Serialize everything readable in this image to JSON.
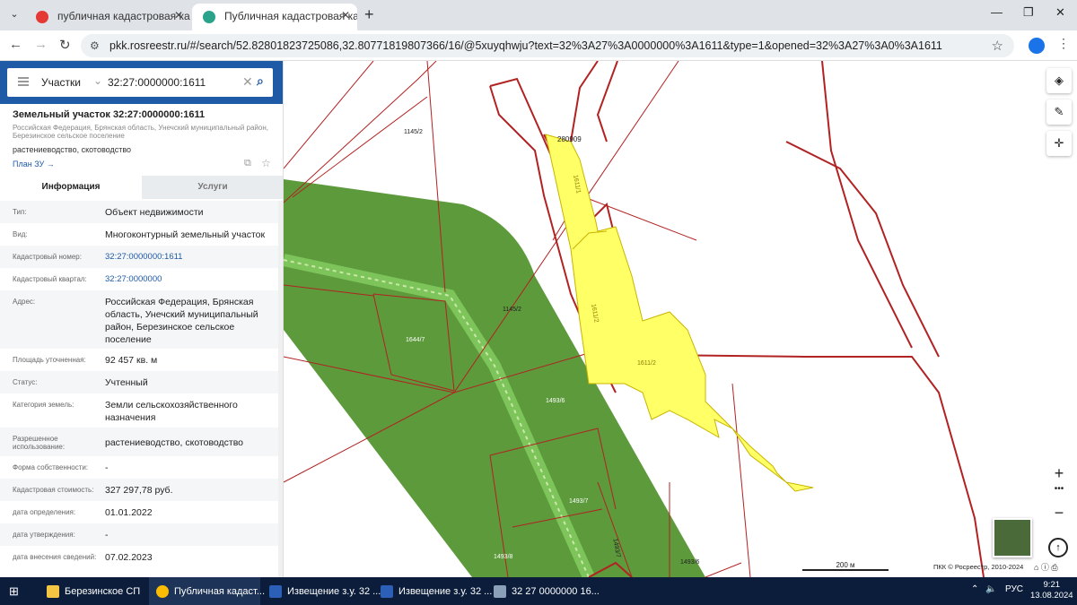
{
  "browser": {
    "tabs": [
      {
        "title": "публичная кадастровая карта",
        "active": false
      },
      {
        "title": "Публичная кадастровая карта",
        "active": true
      }
    ],
    "new_tab": "+",
    "url": "pkk.rosreestr.ru/#/search/52.82801823725086,32.80771819807366/16/@5xuyqhwju?text=32%3A27%3A0000000%3A1611&type=1&opened=32%3A27%3A0%3A1611"
  },
  "search": {
    "type": "Участки",
    "value": "32:27:0000000:1611"
  },
  "object": {
    "title": "Земельный участок 32:27:0000000:1611",
    "address_short": "Российская Федерация, Брянская область, Унечский муниципальный район, Березинское сельское поселение",
    "use": "растениеводство, скотоводство",
    "plan_link": "План ЗУ →"
  },
  "info_tabs": {
    "info": "Информация",
    "services": "Услуги"
  },
  "fields": [
    {
      "k": "Тип:",
      "v": "Объект недвижимости"
    },
    {
      "k": "Вид:",
      "v": "Многоконтурный земельный участок"
    },
    {
      "k": "Кадастровый номер:",
      "v": "32:27:0000000:1611"
    },
    {
      "k": "Кадастровый квартал:",
      "v": "32:27:0000000"
    },
    {
      "k": "Адрес:",
      "v": "Российская Федерация, Брянская область, Унечский муниципальный район, Березинское сельское поселение"
    },
    {
      "k": "Площадь уточненная:",
      "v": "92 457 кв. м"
    },
    {
      "k": "Статус:",
      "v": "Учтенный"
    },
    {
      "k": "Категория земель:",
      "v": "Земли сельскохозяйственного назначения"
    },
    {
      "k": "Разрешенное использование:",
      "v": "растениеводство, скотоводство"
    },
    {
      "k": "Форма собственности:",
      "v": "-"
    },
    {
      "k": "Кадастровая стоимость:",
      "v": "327 297,78 руб."
    },
    {
      "k": "дата определения:",
      "v": "01.01.2022"
    },
    {
      "k": "дата утверждения:",
      "v": "-"
    },
    {
      "k": "дата внесения сведений:",
      "v": "07.02.2023"
    }
  ],
  "map": {
    "labels": {
      "l1145a": "1145/2",
      "l1145b": "1145/2",
      "l280909": "280909",
      "l1611_1": "1611/1",
      "l1611_2a": "1611/2",
      "l1611_2b": "1611/2",
      "l1644": "1644/7",
      "l1493_6a": "1493/6",
      "l1493_7a": "1493/7",
      "l1493_7b": "1493/7",
      "l1493_8": "1493/8",
      "l1493_6b": "1493/6"
    },
    "scale": "200 м",
    "copyright": "ПКК © Росреестр, 2010-2024",
    "zoom_in": "+",
    "zoom_out": "−",
    "colors": {
      "parcel": "#ffff66",
      "forest": "#5c9a3c",
      "border": "#b22222"
    }
  },
  "taskbar": {
    "apps": [
      {
        "title": "Березинское СП",
        "active": false
      },
      {
        "title": "Публичная кадаст...",
        "active": true
      },
      {
        "title": "Извещение з.у. 32 ...",
        "active": false
      },
      {
        "title": "Извещение з.у. 32 ...",
        "active": false
      },
      {
        "title": "32 27 0000000 16...",
        "active": false
      }
    ],
    "lang": "РУС",
    "time": "9:21",
    "date": "13.08.2024"
  }
}
